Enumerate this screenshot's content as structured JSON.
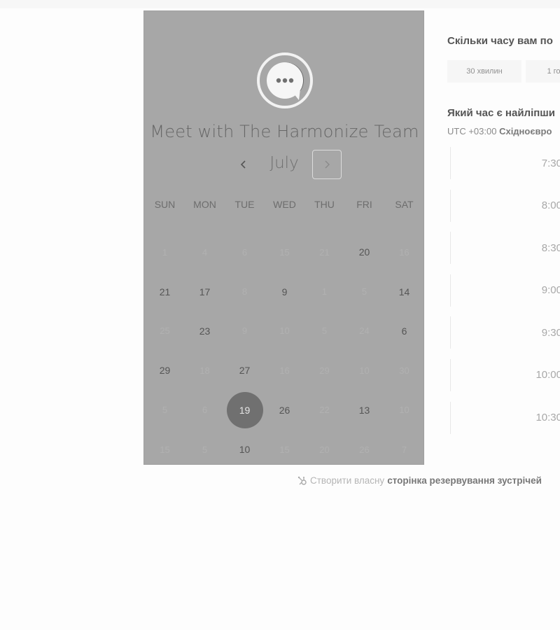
{
  "calendar": {
    "title": "Meet with The Harmonize Team",
    "month": "July",
    "logo_icon": "chat-bubble-icon",
    "weekdays": [
      "SUN",
      "MON",
      "TUE",
      "WED",
      "THU",
      "FRI",
      "SAT"
    ],
    "weeks": [
      [
        {
          "d": "1",
          "s": "d"
        },
        {
          "d": "4",
          "s": "d"
        },
        {
          "d": "6",
          "s": "d"
        },
        {
          "d": "15",
          "s": "d"
        },
        {
          "d": "21",
          "s": "d"
        },
        {
          "d": "20",
          "s": "a"
        },
        {
          "d": "16",
          "s": "d"
        }
      ],
      [
        {
          "d": "21",
          "s": "a"
        },
        {
          "d": "17",
          "s": "a"
        },
        {
          "d": "8",
          "s": "d"
        },
        {
          "d": "9",
          "s": "a"
        },
        {
          "d": "1",
          "s": "d"
        },
        {
          "d": "5",
          "s": "d"
        },
        {
          "d": "14",
          "s": "a"
        }
      ],
      [
        {
          "d": "25",
          "s": "d"
        },
        {
          "d": "23",
          "s": "a"
        },
        {
          "d": "9",
          "s": "d"
        },
        {
          "d": "10",
          "s": "d"
        },
        {
          "d": "5",
          "s": "d"
        },
        {
          "d": "24",
          "s": "d"
        },
        {
          "d": "6",
          "s": "a"
        }
      ],
      [
        {
          "d": "29",
          "s": "a"
        },
        {
          "d": "18",
          "s": "d"
        },
        {
          "d": "27",
          "s": "a"
        },
        {
          "d": "16",
          "s": "d"
        },
        {
          "d": "29",
          "s": "d"
        },
        {
          "d": "10",
          "s": "d"
        },
        {
          "d": "30",
          "s": "d"
        }
      ],
      [
        {
          "d": "5",
          "s": "d"
        },
        {
          "d": "6",
          "s": "d"
        },
        {
          "d": "19",
          "s": "s"
        },
        {
          "d": "26",
          "s": "a"
        },
        {
          "d": "22",
          "s": "d"
        },
        {
          "d": "13",
          "s": "a"
        },
        {
          "d": "10",
          "s": "d"
        }
      ],
      [
        {
          "d": "15",
          "s": "d"
        },
        {
          "d": "5",
          "s": "d"
        },
        {
          "d": "10",
          "s": "a"
        },
        {
          "d": "15",
          "s": "d"
        },
        {
          "d": "20",
          "s": "d"
        },
        {
          "d": "26",
          "s": "d"
        },
        {
          "d": "7",
          "s": "d"
        }
      ]
    ]
  },
  "booking": {
    "duration_question": "Скільки часу вам по",
    "durations": [
      "30 хвилин",
      "1 го"
    ],
    "time_question": "Який час є найліпши",
    "timezone_offset": "UTC +03:00",
    "timezone_name": "Східноєвро",
    "slots": [
      "7:30",
      "8:00",
      "8:30",
      "9:00",
      "9:30",
      "10:00",
      "10:30"
    ]
  },
  "footer": {
    "prefix": "Створити власну",
    "link": "сторінка резервування зустрічей",
    "icon": "hubspot-sprocket-icon"
  },
  "colors": {
    "panel": "#a7a7a7",
    "selected_day": "#707070"
  }
}
